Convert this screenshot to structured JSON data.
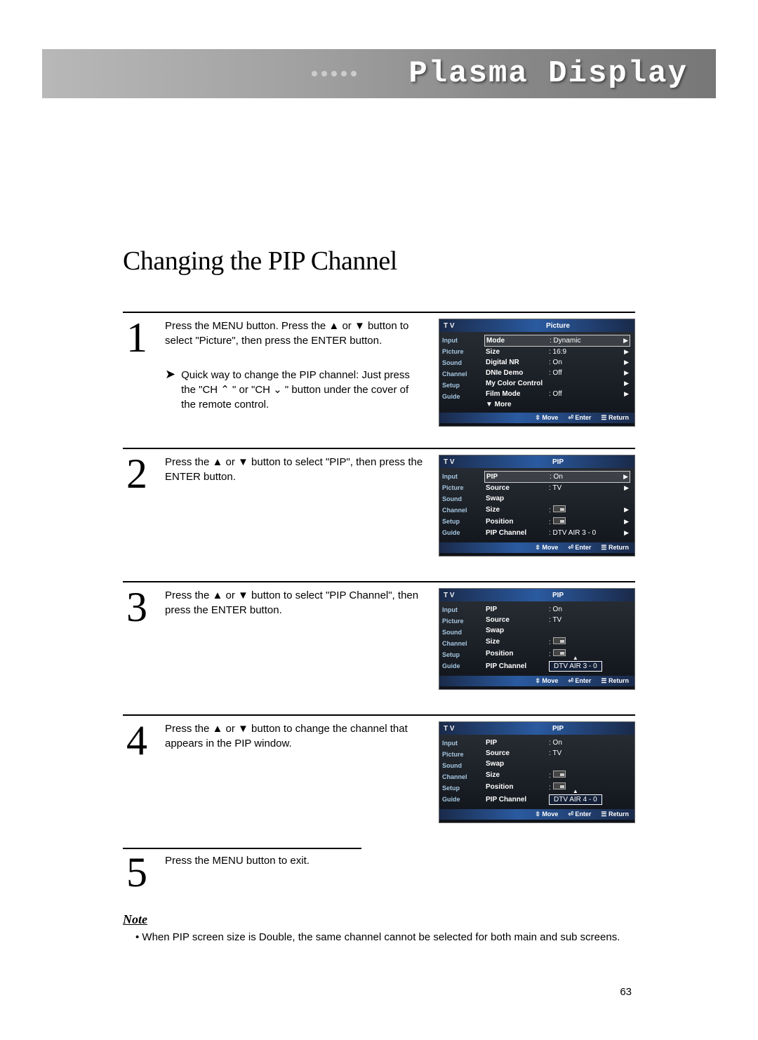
{
  "banner": {
    "title": "Plasma Display"
  },
  "page": {
    "title": "Changing the PIP Channel",
    "number": "63"
  },
  "steps": [
    {
      "num": "1",
      "text": "Press the MENU button. Press the ▲ or ▼ button to select \"Picture\", then press the ENTER button.",
      "quick": "Quick way to change the PIP channel: Just press the \"CH ⌃ \" or \"CH ⌄ \" button under the cover of the remote control."
    },
    {
      "num": "2",
      "text": "Press the ▲ or ▼ button to select \"PIP\", then press the ENTER button."
    },
    {
      "num": "3",
      "text": "Press the ▲ or ▼ button to select \"PIP Channel\", then press the ENTER button."
    },
    {
      "num": "4",
      "text": "Press the ▲ or ▼ button to change the channel that appears in the PIP window."
    },
    {
      "num": "5",
      "text": "Press the MENU button to exit."
    }
  ],
  "note": {
    "heading": "Note",
    "body": "When PIP screen size is Double, the same channel cannot be selected for both main and sub screens."
  },
  "osd_common": {
    "tv": "T V",
    "side": [
      "Input",
      "Picture",
      "Sound",
      "Channel",
      "Setup",
      "Guide"
    ],
    "foot_move": "Move",
    "foot_enter": "Enter",
    "foot_return": "Return"
  },
  "osd_picture": {
    "title": "Picture",
    "rows": [
      {
        "label": "Mode",
        "val": ": Dynamic",
        "arrow": true,
        "selected": true
      },
      {
        "label": "Size",
        "val": ": 16:9",
        "arrow": true
      },
      {
        "label": "Digital NR",
        "val": ": On",
        "arrow": true
      },
      {
        "label": "DNIe Demo",
        "val": ": Off",
        "arrow": true
      },
      {
        "label": "My Color Control",
        "val": "",
        "arrow": true
      },
      {
        "label": "Film Mode",
        "val": ": Off",
        "arrow": true
      },
      {
        "label": "▼ More",
        "val": "",
        "arrow": false
      }
    ]
  },
  "osd_pip2": {
    "title": "PIP",
    "rows": [
      {
        "label": "PIP",
        "val": ": On",
        "arrow": true,
        "selected": true
      },
      {
        "label": "Source",
        "val": ": TV",
        "arrow": true
      },
      {
        "label": "Swap",
        "val": "",
        "arrow": false
      },
      {
        "label": "Size",
        "val": ":",
        "icon": true,
        "arrow": true
      },
      {
        "label": "Position",
        "val": ":",
        "icon": true,
        "arrow": true
      },
      {
        "label": "PIP Channel",
        "val": ": DTV AIR 3 - 0",
        "arrow": true
      }
    ]
  },
  "osd_pip3": {
    "title": "PIP",
    "rows": [
      {
        "label": "PIP",
        "val": ": On"
      },
      {
        "label": "Source",
        "val": ": TV"
      },
      {
        "label": "Swap",
        "val": ""
      },
      {
        "label": "Size",
        "val": ":",
        "icon": true
      },
      {
        "label": "Position",
        "val": ":",
        "icon": true
      },
      {
        "label": "PIP Channel",
        "val": ":",
        "selval": "DTV AIR 3 - 0"
      }
    ]
  },
  "osd_pip4": {
    "title": "PIP",
    "rows": [
      {
        "label": "PIP",
        "val": ": On"
      },
      {
        "label": "Source",
        "val": ": TV"
      },
      {
        "label": "Swap",
        "val": ""
      },
      {
        "label": "Size",
        "val": ":",
        "icon": true
      },
      {
        "label": "Position",
        "val": ":",
        "icon": true
      },
      {
        "label": "PIP Channel",
        "val": ":",
        "selval": "DTV AIR 4 - 0"
      }
    ]
  }
}
